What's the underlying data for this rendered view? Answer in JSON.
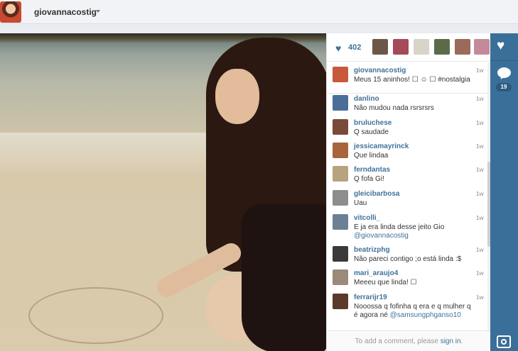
{
  "header": {
    "username": "giovannacostig"
  },
  "likes": {
    "count": "402"
  },
  "comments": [
    {
      "user": "giovannacostig",
      "text": "Meus 15 aninhos! ☐ ☺ ☐ #nostalgia",
      "time": "1w",
      "color": "#c75a3a"
    },
    {
      "user": "danlino",
      "text": "Não mudou nada rsrsrsrs",
      "time": "1w",
      "color": "#4a6d9a"
    },
    {
      "user": "bruluchese",
      "text": "Q saudade",
      "time": "1w",
      "color": "#7a4a3a"
    },
    {
      "user": "jessicamayrinck",
      "text": "Que lindaa",
      "time": "1w",
      "color": "#a8643a"
    },
    {
      "user": "ferndantas",
      "text": "Q fofa Gi!",
      "time": "1w",
      "color": "#b7a37e"
    },
    {
      "user": "gleicibarbosa",
      "text": "Uau",
      "time": "1w",
      "color": "#8d8d8d"
    },
    {
      "user": "vitcolli_",
      "text": "E ja era linda desse jeito Gio",
      "mention": "@giovannacostig",
      "time": "1w",
      "color": "#6d7f94"
    },
    {
      "user": "beatrizphg",
      "text": "Não pareci contigo ;o está linda :$",
      "time": "1w",
      "color": "#3a3a3a"
    },
    {
      "user": "mari_araujo4",
      "text": "Meeeu que linda! ☐",
      "time": "1w",
      "color": "#9b8a7a"
    },
    {
      "user": "ferrarijr19",
      "text": "Nooossa q fofinha q era e q mulher q é agora né",
      "mention": "@samsungphganso10",
      "time": "1w",
      "color": "#5a3a2a"
    }
  ],
  "add_comment": {
    "prefix": "To add a comment, please",
    "link": "sign in",
    "suffix": "."
  },
  "right_bar": {
    "comment_count": "19"
  },
  "icons": {
    "like": "heart-icon",
    "comment": "comment-bubble-icon",
    "brand": "instagram-camera-icon"
  },
  "colors": {
    "link_blue": "#3f729b",
    "sidebar_blue": "#3a6f9a"
  }
}
